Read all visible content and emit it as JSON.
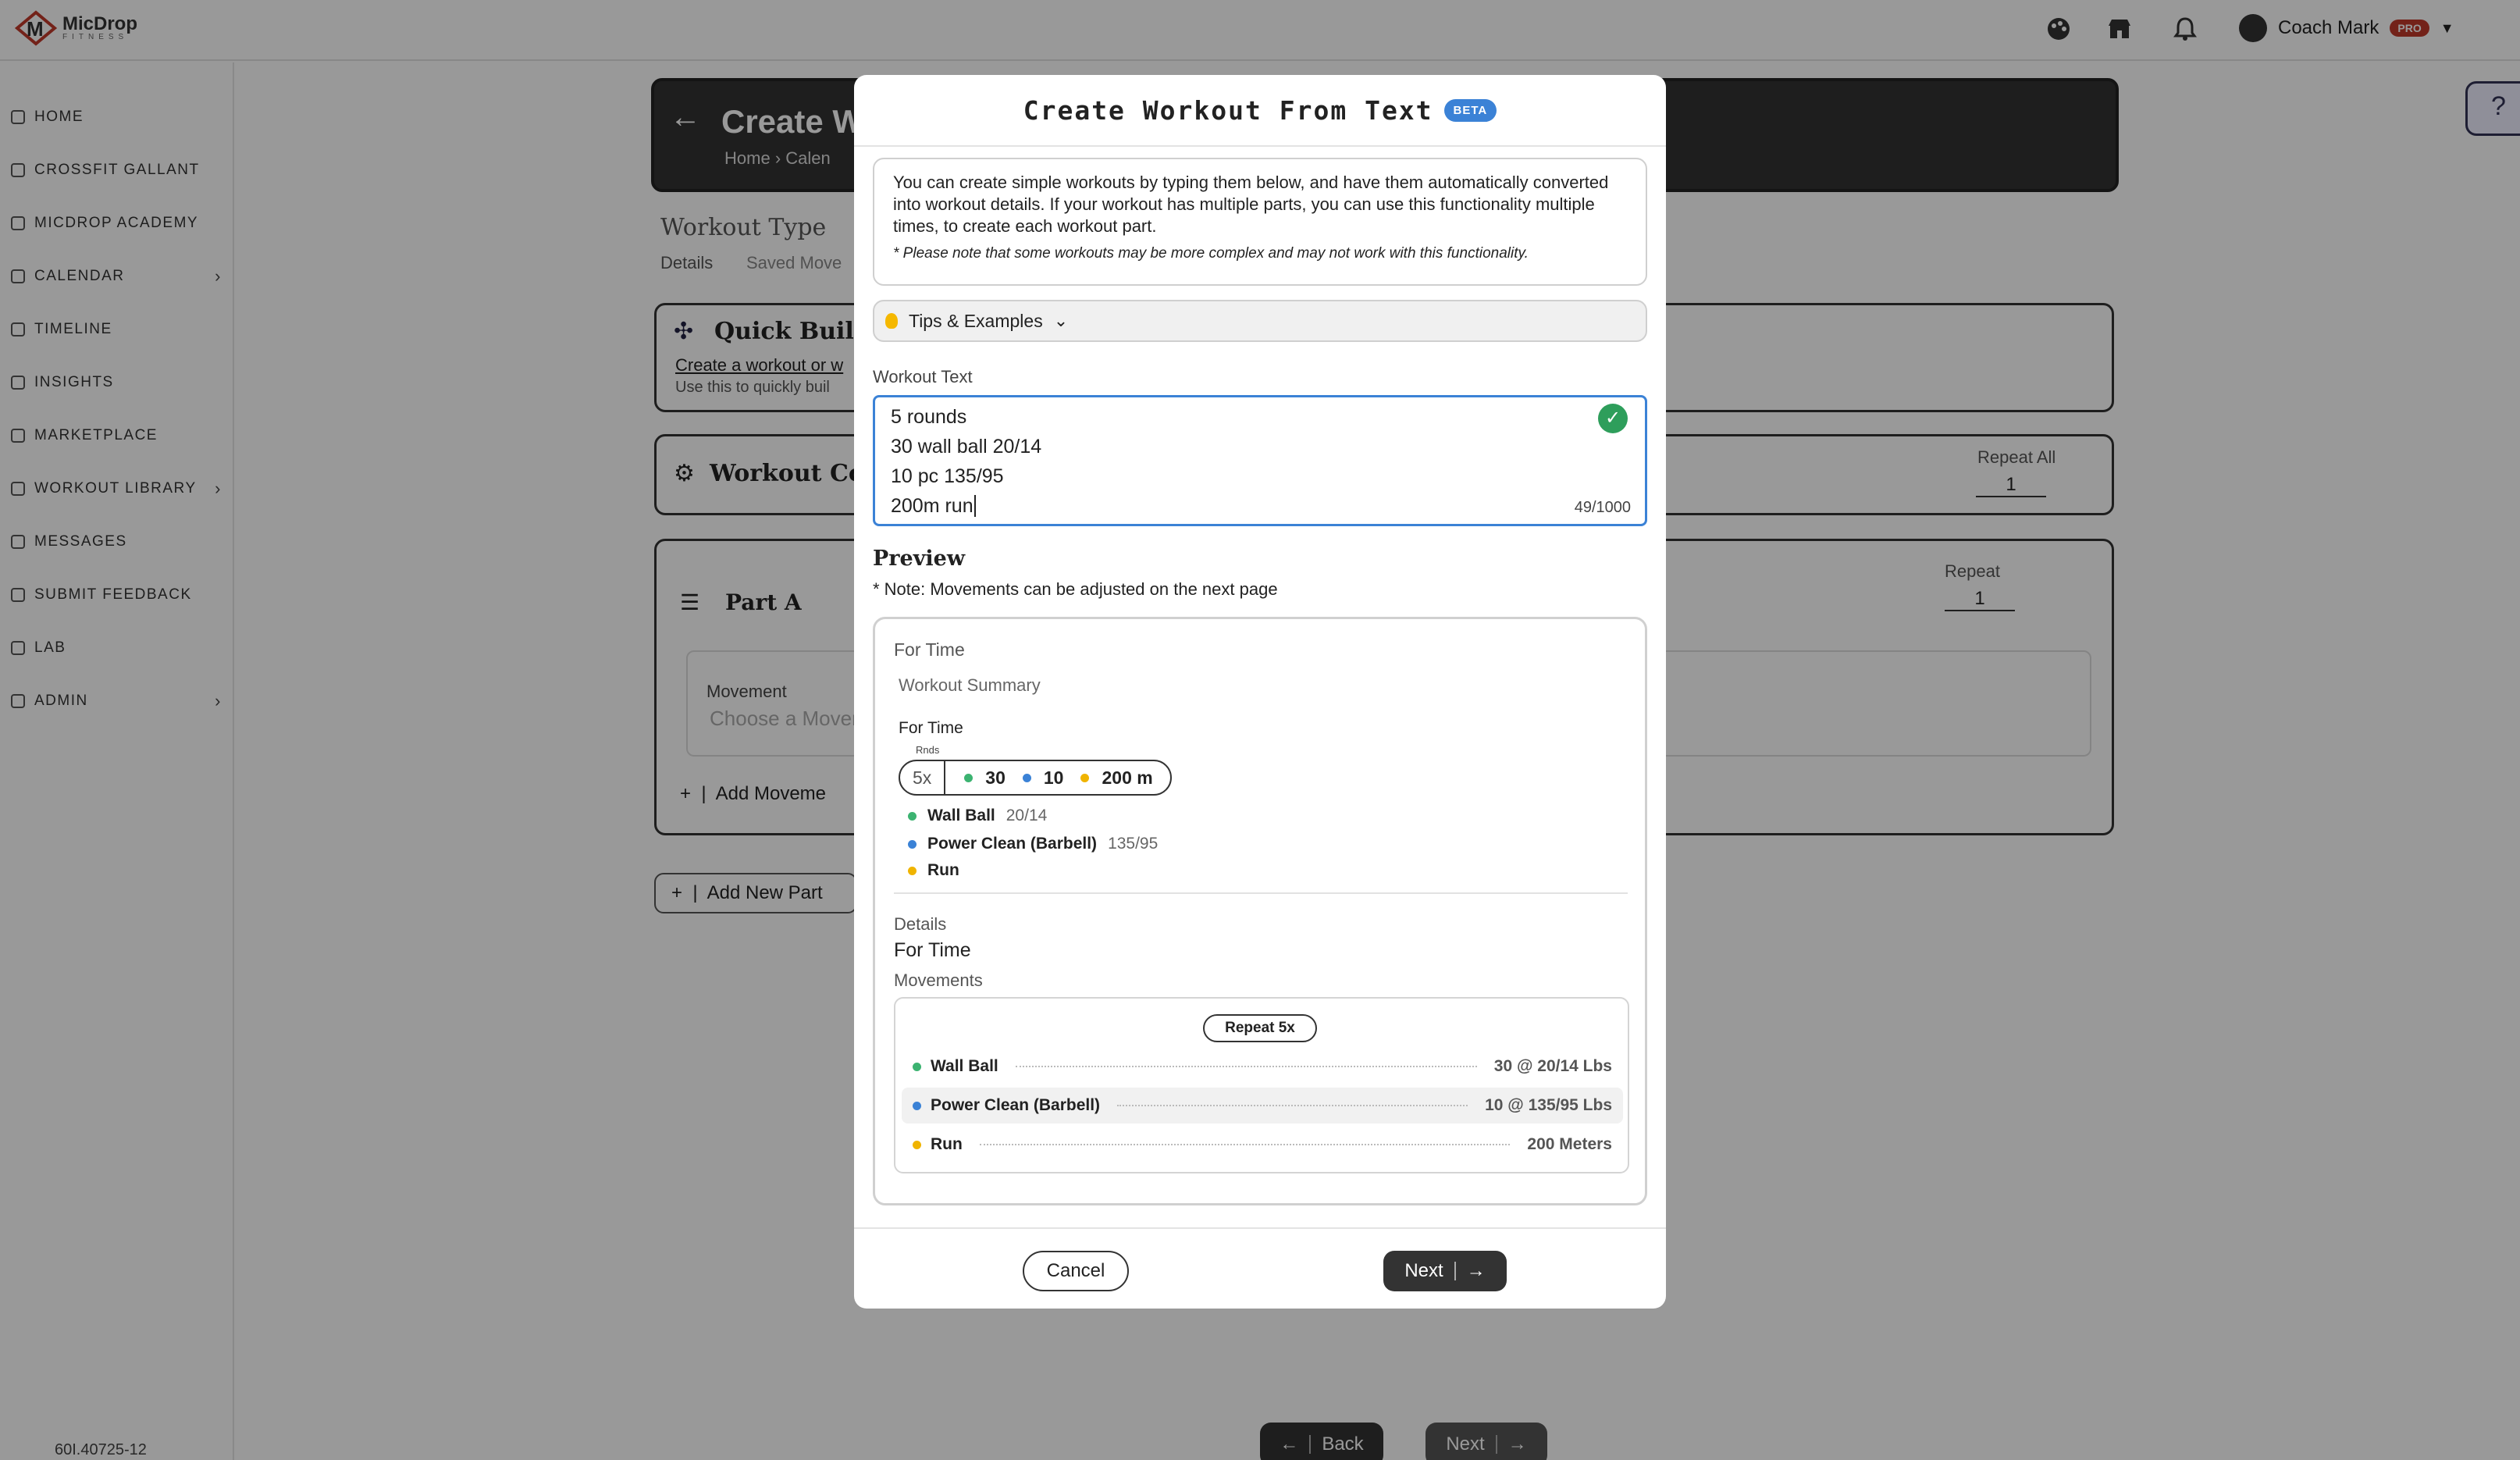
{
  "brand": {
    "name": "MicDrop",
    "sub": "FITNESS"
  },
  "header": {
    "coach_name": "Coach Mark",
    "pro_badge": "PRO"
  },
  "sidebar": {
    "items": [
      {
        "label": "HOME"
      },
      {
        "label": "CROSSFIT GALLANT"
      },
      {
        "label": "MICDROP ACADEMY"
      },
      {
        "label": "CALENDAR",
        "has_chevron": true
      },
      {
        "label": "TIMELINE"
      },
      {
        "label": "INSIGHTS"
      },
      {
        "label": "MARKETPLACE"
      },
      {
        "label": "WORKOUT LIBRARY",
        "has_chevron": true
      },
      {
        "label": "MESSAGES"
      },
      {
        "label": "SUBMIT FEEDBACK"
      },
      {
        "label": "LAB"
      },
      {
        "label": "ADMIN",
        "has_chevron": true
      }
    ],
    "version": "60I.40725-12"
  },
  "background": {
    "page_title": "Create W",
    "breadcrumb_home": "Home",
    "breadcrumb_next": "Calen",
    "workout_type_label": "Workout Type",
    "tab_details": "Details",
    "tab_saved": "Saved Move",
    "quick_build_title": "Quick Build",
    "quick_build_link": "Create a workout or w",
    "quick_build_hint": "Use this to quickly buil",
    "workout_config_title": "Workout Co",
    "repeat_all_label": "Repeat All",
    "repeat_all_value": "1",
    "part_label": "Part A",
    "repeat_label": "Repeat",
    "repeat_value": "1",
    "movement_label": "Movement",
    "movement_placeholder": "Choose a Movem",
    "add_movement": "Add Moveme",
    "add_new_part": "Add New Part",
    "back_button": "Back",
    "next_button": "Next"
  },
  "modal": {
    "title": "Create Workout From Text",
    "badge": "BETA",
    "info_text": "You can create simple workouts by typing them below, and have them automatically converted into workout details. If your workout has multiple parts, you can use this functionality multiple times, to create each workout part.",
    "info_note": "* Please note that some workouts may be more complex and may not work with this functionality.",
    "tips_label": "Tips & Examples",
    "workout_text_label": "Workout Text",
    "workout_text_lines": [
      "5 rounds",
      "30 wall ball 20/14",
      "10 pc 135/95",
      "200m run"
    ],
    "char_count": "49/1000",
    "preview_title": "Preview",
    "preview_note": "* Note: Movements can be adjusted on the next page",
    "preview": {
      "type": "For Time",
      "summary_label": "Workout Summary",
      "summary_type": "For Time",
      "rounds_label": "Rnds",
      "rounds": "5x",
      "summary_items": [
        {
          "value": "30",
          "color": "#3cb371"
        },
        {
          "value": "10",
          "color": "#3b82d6"
        },
        {
          "value": "200 m",
          "color": "#f0b400"
        }
      ],
      "movements_list": [
        {
          "name": "Wall Ball",
          "sub": "20/14",
          "color": "#3cb371"
        },
        {
          "name": "Power Clean (Barbell)",
          "sub": "135/95",
          "color": "#3b82d6"
        },
        {
          "name": "Run",
          "sub": "",
          "color": "#f0b400"
        }
      ],
      "details_label": "Details",
      "details_value": "For Time",
      "movements_label": "Movements",
      "repeat_button": "Repeat 5x",
      "movement_rows": [
        {
          "name": "Wall Ball",
          "value": "30 @ 20/14 Lbs",
          "color": "#3cb371"
        },
        {
          "name": "Power Clean (Barbell)",
          "value": "10 @ 135/95 Lbs",
          "color": "#3b82d6"
        },
        {
          "name": "Run",
          "value": "200 Meters",
          "color": "#f0b400"
        }
      ]
    },
    "cancel_label": "Cancel",
    "next_label": "Next"
  }
}
